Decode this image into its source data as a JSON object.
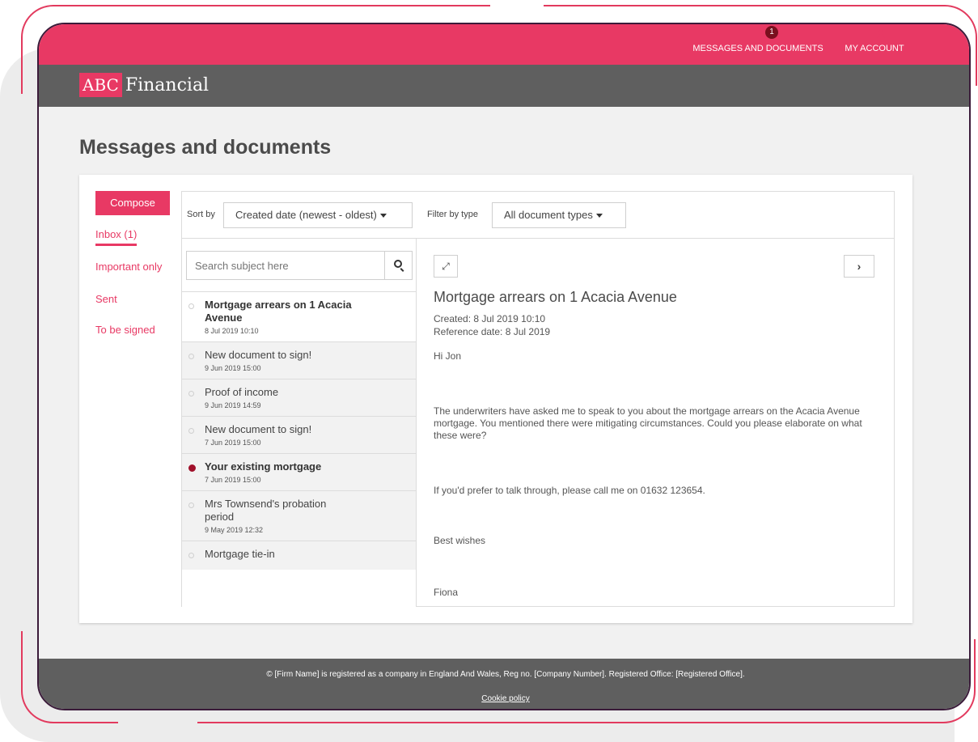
{
  "header": {
    "messages_label": "MESSAGES AND DOCUMENTS",
    "messages_badge": "1",
    "account_label": "MY ACCOUNT"
  },
  "brand": {
    "logo_mark": "ABC",
    "logo_text": "Financial"
  },
  "page": {
    "title": "Messages and documents"
  },
  "sidebar": {
    "compose_label": "Compose",
    "items": [
      {
        "label": "Inbox (1)"
      },
      {
        "label": "Important only"
      },
      {
        "label": "Sent"
      },
      {
        "label": "To be signed"
      }
    ]
  },
  "toolbar": {
    "sort_label": "Sort by",
    "sort_value": "Created date (newest - oldest)",
    "filter_label": "Filter by type",
    "filter_value": "All document types"
  },
  "search": {
    "placeholder": "Search subject here"
  },
  "messages": [
    {
      "subject": "Mortgage arrears on 1 Acacia Avenue",
      "date": "8 Jul 2019 10:10"
    },
    {
      "subject": "New document to sign!",
      "date": "9 Jun 2019 15:00"
    },
    {
      "subject": "Proof of income",
      "date": "9 Jun 2019 14:59"
    },
    {
      "subject": "New document to sign!",
      "date": "7 Jun 2019 15:00"
    },
    {
      "subject": "Your existing mortgage",
      "date": "7 Jun 2019 15:00"
    },
    {
      "subject": "Mrs Townsend's probation period",
      "date": "9 May 2019 12:32"
    },
    {
      "subject": "Mortgage tie-in",
      "date": ""
    }
  ],
  "detail": {
    "subject": "Mortgage arrears on 1 Acacia Avenue",
    "created": "Created: 8 Jul 2019 10:10",
    "reference": "Reference date: 8 Jul 2019",
    "greeting": "Hi Jon",
    "paragraph1": "The underwriters have asked me to speak to you about the mortgage arrears on the Acacia Avenue mortgage.  You mentioned there were mitigating circumstances. Could you please elaborate on what these were?",
    "paragraph2": "If you'd prefer to talk through, please call me on 01632 123654.",
    "signoff": "Best wishes",
    "signature": "Fiona"
  },
  "footer": {
    "text": "© [Firm Name] is registered as a company in England And Wales, Reg no. [Company Number]. Registered Office: [Registered Office].",
    "cookie_label": "Cookie policy"
  },
  "colors": {
    "accent": "#e83964",
    "dark_bar": "#5f5f5f",
    "unread_dot": "#a0102a"
  }
}
